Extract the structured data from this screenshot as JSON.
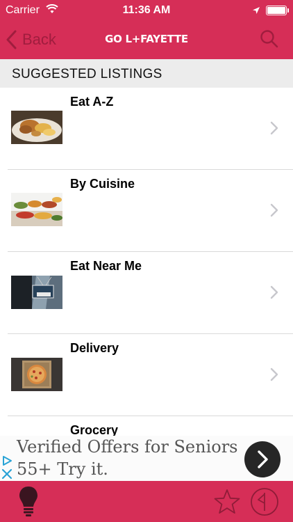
{
  "status_bar": {
    "carrier": "Carrier",
    "time": "11:36 AM"
  },
  "nav": {
    "back_label": "Back",
    "title": "GO L+FAYETTE"
  },
  "section": {
    "header": "SUGGESTED LISTINGS"
  },
  "listings": [
    {
      "title": "Eat A-Z",
      "image": "fried-chicken-plate"
    },
    {
      "title": "By Cuisine",
      "image": "buffet-spread"
    },
    {
      "title": "Eat Near Me",
      "image": "open-sign"
    },
    {
      "title": "Delivery",
      "image": "pizza-box"
    },
    {
      "title": "Grocery",
      "image": "grocery"
    }
  ],
  "ad": {
    "line1": "Verified Offers for Seniors",
    "line2": "55+ Try it."
  },
  "colors": {
    "brand": "#d62e57",
    "brand_dark": "#a01d3e",
    "header_bg": "#ececec"
  },
  "tabbar": {
    "icons": [
      "lightbulb-icon",
      "star-icon",
      "flag-circle-icon"
    ]
  }
}
